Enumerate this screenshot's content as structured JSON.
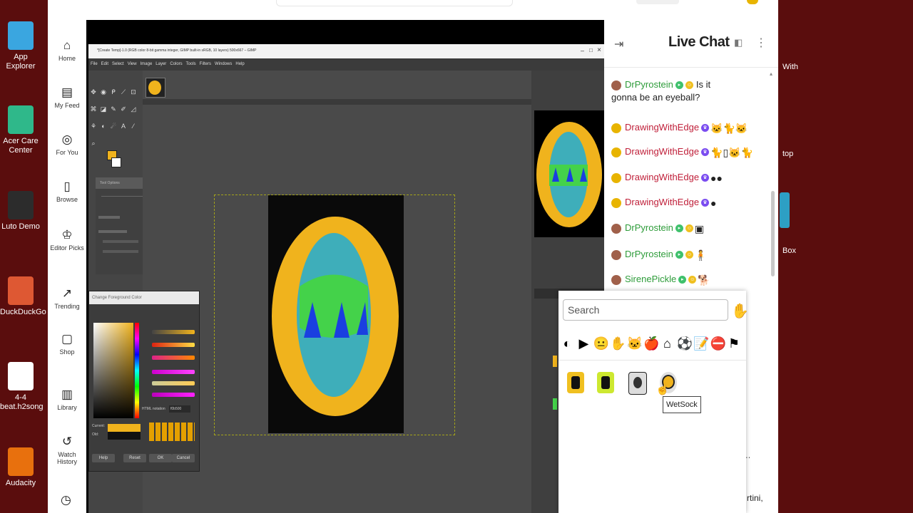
{
  "desktop_left": [
    {
      "label": "App Explorer",
      "color": "#3aa6e0"
    },
    {
      "label": "Acer Care Center",
      "color": "#2fb88a"
    },
    {
      "label": "Luto Demo",
      "color": "#2c2c2c"
    },
    {
      "label": "DuckDuckGo",
      "color": "#de5833"
    },
    {
      "label": "4-4 beat.h2song",
      "color": "#ffffff"
    },
    {
      "label": "Audacity",
      "color": "#e8700d"
    }
  ],
  "desktop_right": {
    "with": "With",
    "top": "top",
    "box": "Box"
  },
  "browser_nav": [
    {
      "label": "Home",
      "icon": "home-icon",
      "glyph": "⌂"
    },
    {
      "label": "My Feed",
      "icon": "feed-icon",
      "glyph": "▤"
    },
    {
      "label": "For You",
      "icon": "target-icon",
      "glyph": "◎"
    },
    {
      "label": "Browse",
      "icon": "browse-icon",
      "glyph": "▯"
    },
    {
      "label": "Editor Picks",
      "icon": "award-icon",
      "glyph": "♔"
    },
    {
      "label": "Trending",
      "icon": "trending-icon",
      "glyph": "↗"
    },
    {
      "label": "Shop",
      "icon": "shop-icon",
      "glyph": "▢"
    },
    {
      "label": "Library",
      "icon": "library-icon",
      "glyph": "▥"
    },
    {
      "label": "Watch History",
      "icon": "history-icon",
      "glyph": "↺"
    }
  ],
  "gimp": {
    "title": "*[Create Temp]-1.0 (RGB color 8-bit gamma integer, GIMP built-in sRGB, 10 layers) 500x667 – GIMP",
    "menu": [
      "File",
      "Edit",
      "Select",
      "View",
      "Image",
      "Layer",
      "Colors",
      "Tools",
      "Filters",
      "Windows",
      "Help"
    ],
    "tool_options": "Tool Options",
    "fg_dialog_title": "Change Foreground Color",
    "html_notation_label": "HTML notation",
    "html_notation_value": "f0b500",
    "current_label": "Current:",
    "old_label": "Old:",
    "buttons": [
      "Help",
      "Reset",
      "OK",
      "Cancel"
    ],
    "canvas_colors": {
      "bg": "#0a0a0a",
      "outer": "#f0b31d",
      "inner": "#3eaeba",
      "band": "#44d24a",
      "spikes": "#1a3fe0"
    }
  },
  "chat": {
    "title": "Live Chat",
    "messages": [
      {
        "user": "DrPyrostein",
        "text": "Is it gonna be an eyeball?",
        "color": "green",
        "emotes": ""
      },
      {
        "user": "DrawingWithEdge",
        "text": "",
        "color": "red",
        "emotes": "🐱🐈🐱"
      },
      {
        "user": "DrawingWithEdge",
        "text": "",
        "color": "red",
        "emotes": "🐈▯🐱🐈"
      },
      {
        "user": "DrawingWithEdge",
        "text": "",
        "color": "red",
        "emotes": "●●"
      },
      {
        "user": "DrawingWithEdge",
        "text": "",
        "color": "red",
        "emotes": "●"
      },
      {
        "user": "DrPyrostein",
        "text": "",
        "color": "green",
        "emotes": "▣"
      },
      {
        "user": "DrPyrostein",
        "text": "",
        "color": "green",
        "emotes": "🧍"
      },
      {
        "user": "SirenePickle",
        "text": "",
        "color": "green",
        "emotes": "🐕"
      }
    ]
  },
  "picker": {
    "search_placeholder": "Search",
    "categories": [
      {
        "name": "channel-emotes-icon",
        "glyph": "◐"
      },
      {
        "name": "play-icon",
        "glyph": "▶"
      },
      {
        "name": "smiley-icon",
        "glyph": "😐"
      },
      {
        "name": "hand-icon",
        "glyph": "✋"
      },
      {
        "name": "cat-icon",
        "glyph": "🐱"
      },
      {
        "name": "apple-icon",
        "glyph": "🍎"
      },
      {
        "name": "house-icon",
        "glyph": "⌂"
      },
      {
        "name": "ball-icon",
        "glyph": "⚽"
      },
      {
        "name": "note-icon",
        "glyph": "📝"
      },
      {
        "name": "stop-icon",
        "glyph": "⛔"
      },
      {
        "name": "flag-icon",
        "glyph": "⚑"
      }
    ],
    "tooltip": "WetSock",
    "chat_fragment": "rtini,"
  }
}
